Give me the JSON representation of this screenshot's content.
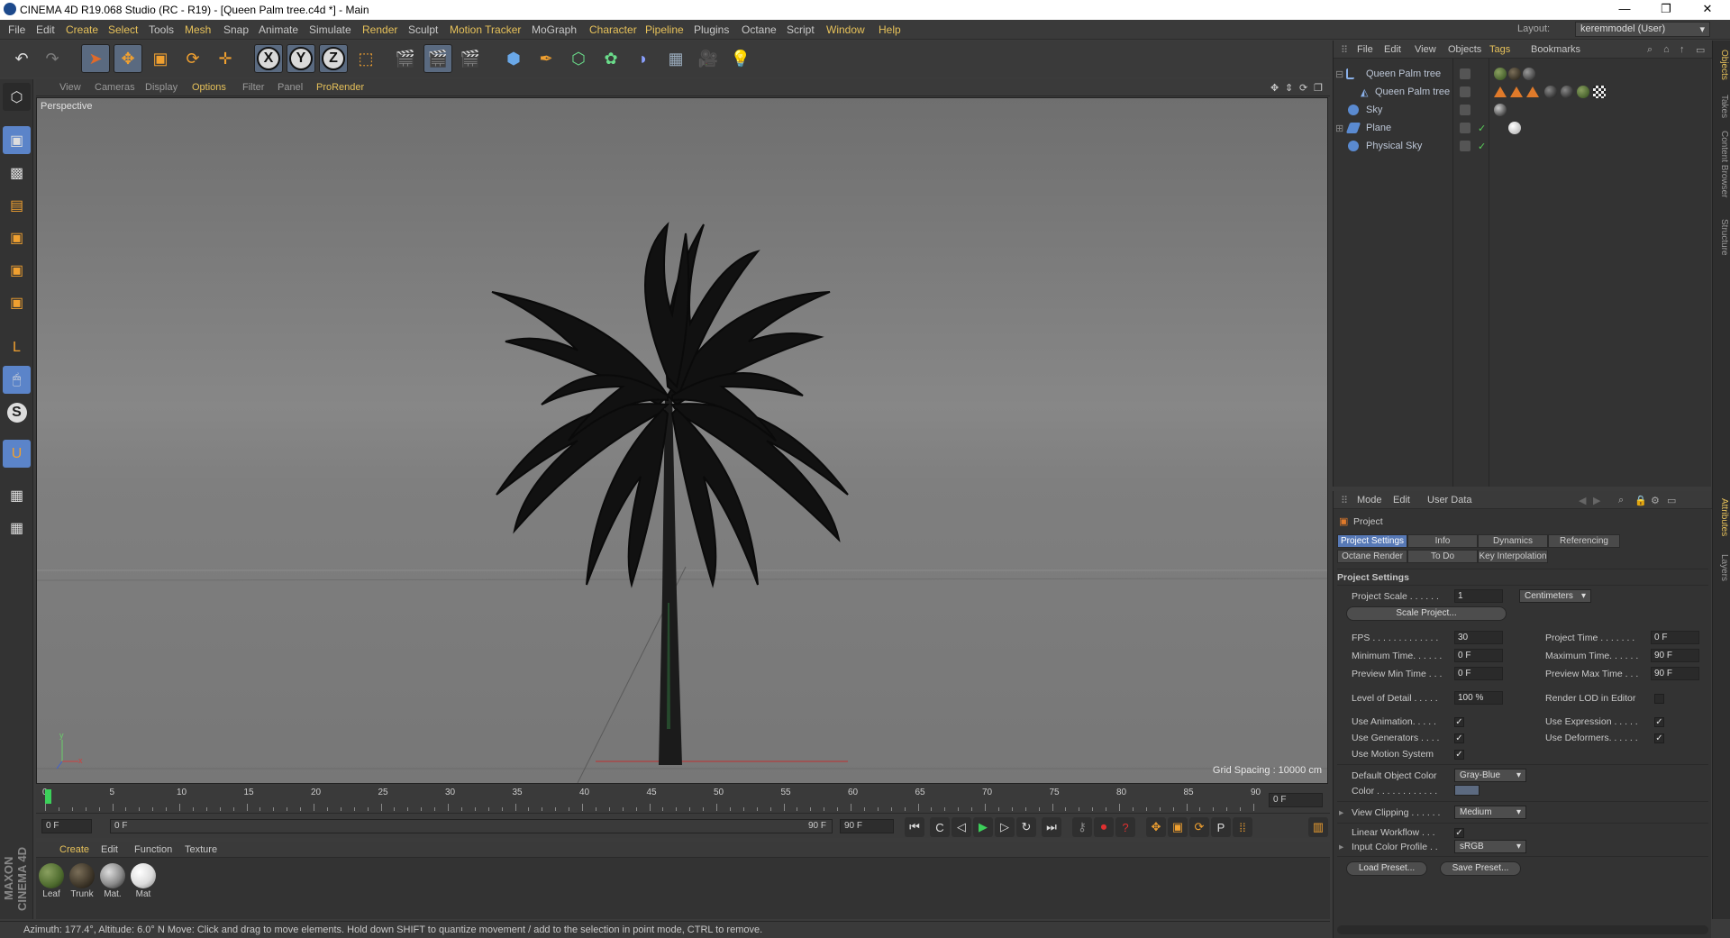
{
  "window": {
    "title": "CINEMA 4D R19.068 Studio (RC - R19) - [Queen Palm tree.c4d *] - Main",
    "minimize": "—",
    "maximize": "❐",
    "close": "✕"
  },
  "menubar": {
    "items": [
      "File",
      "Edit",
      "Create",
      "Select",
      "Tools",
      "Mesh",
      "Snap",
      "Animate",
      "Simulate",
      "Render",
      "Sculpt",
      "Motion Tracker",
      "MoGraph",
      "Character",
      "Pipeline",
      "Plugins",
      "Octane",
      "Script",
      "Window",
      "Help"
    ],
    "layout_label": "Layout:",
    "layout_value": "keremmodel (User)"
  },
  "toolbar": {
    "x_label": "X",
    "y_label": "Y",
    "z_label": "Z"
  },
  "viewport": {
    "menu": [
      "View",
      "Cameras",
      "Display",
      "Options",
      "Filter",
      "Panel",
      "ProRender"
    ],
    "label": "Perspective",
    "grid_spacing": "Grid Spacing : 10000 cm",
    "axis_y": "y",
    "axis_x": "x"
  },
  "timeline": {
    "ticks": [
      "0",
      "5",
      "10",
      "15",
      "20",
      "25",
      "30",
      "35",
      "40",
      "45",
      "50",
      "55",
      "60",
      "65",
      "70",
      "75",
      "80",
      "85",
      "90"
    ],
    "current_frame": "0 F",
    "start_field": "0 F",
    "range_start": "0 F",
    "range_end": "90 F",
    "end_field": "90 F"
  },
  "materials": {
    "menu": [
      "Create",
      "Edit",
      "Function",
      "Texture"
    ],
    "items": [
      {
        "label": "Leaf",
        "color": "#4e6b2e"
      },
      {
        "label": "Trunk",
        "color": "#3d3528"
      },
      {
        "label": "Mat.",
        "color": "#8a8a8a"
      },
      {
        "label": "Mat",
        "color": "#dcdcdc"
      }
    ],
    "brand": "MAXON CINEMA 4D"
  },
  "statusbar": {
    "text": "Azimuth: 177.4°, Altitude: 6.0°  N      Move: Click and drag to move elements. Hold down SHIFT to quantize movement / add to the selection in point mode, CTRL to remove."
  },
  "object_manager": {
    "menu": [
      "File",
      "Edit",
      "View",
      "Objects",
      "Tags",
      "Bookmarks"
    ],
    "objects": [
      {
        "name": "Queen Palm tree"
      },
      {
        "name": "Queen Palm tree"
      },
      {
        "name": "Sky"
      },
      {
        "name": "Plane"
      },
      {
        "name": "Physical Sky"
      }
    ]
  },
  "right_tabs": [
    "Objects",
    "Takes",
    "Content Browser",
    "Structure",
    "Attributes",
    "Layers"
  ],
  "attribute_manager": {
    "menu": [
      "Mode",
      "Edit",
      "User Data"
    ],
    "header": "Project",
    "tabs_row1": [
      "Project Settings",
      "Info",
      "Dynamics",
      "Referencing"
    ],
    "tabs_row2": [
      "Octane Render",
      "To Do",
      "Key Interpolation"
    ],
    "section": "Project Settings",
    "project_scale_label": "Project Scale . . . . . .",
    "project_scale_value": "1",
    "project_scale_unit": "Centimeters",
    "scale_project_button": "Scale Project...",
    "fps_label": "FPS . . . . . . . . . . . . .",
    "fps_value": "30",
    "project_time_label": "Project Time . . . . . . .",
    "project_time_value": "0 F",
    "min_time_label": "Minimum Time. . . . . .",
    "min_time_value": "0 F",
    "max_time_label": "Maximum Time. . . . . .",
    "max_time_value": "90 F",
    "preview_min_label": "Preview Min Time . . .",
    "preview_min_value": "0 F",
    "preview_max_label": "Preview Max Time . . .",
    "preview_max_value": "90 F",
    "lod_label": "Level of Detail . . . . .",
    "lod_value": "100 %",
    "render_lod_label": "Render LOD in Editor",
    "use_animation_label": "Use Animation. . . . .",
    "use_expression_label": "Use Expression . . . . .",
    "use_generators_label": "Use Generators . . . .",
    "use_deformers_label": "Use Deformers. . . . . .",
    "use_motion_label": "Use Motion System",
    "default_color_label": "Default Object Color",
    "default_color_value": "Gray-Blue",
    "color_label": "Color . . . . . . . . . . . .",
    "view_clipping_label": "View Clipping . . . . . .",
    "view_clipping_value": "Medium",
    "linear_workflow_label": "Linear Workflow . . .",
    "input_color_label": "Input Color Profile . .",
    "input_color_value": "sRGB",
    "load_preset": "Load Preset...",
    "save_preset": "Save Preset..."
  }
}
